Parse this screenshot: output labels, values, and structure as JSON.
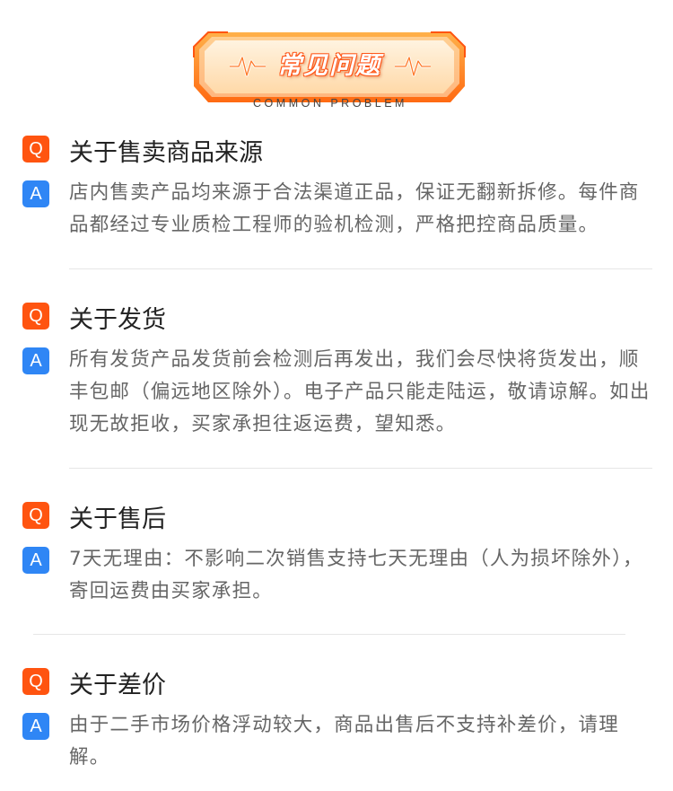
{
  "header": {
    "title": "常见问题",
    "subtitle": "COMMON PROBLEM",
    "colors": {
      "banner_outer": "#ff7a1a",
      "banner_inner": "#ffe0b8",
      "title_fill": "#ffffff"
    }
  },
  "colors": {
    "q_badge": "#ff5410",
    "a_badge": "#2f86f5",
    "question_text": "#222222",
    "answer_text": "#666666",
    "divider": "#e6e6e6"
  },
  "faq": [
    {
      "q_badge": "Q",
      "a_badge": "A",
      "question": "关于售卖商品来源",
      "answer": "店内售卖产品均来源于合法渠道正品，保证无翻新拆修。每件商品都经过专业质检工程师的验机检测，严格把控商品质量。"
    },
    {
      "q_badge": "Q",
      "a_badge": "A",
      "question": "关于发货",
      "answer": "所有发货产品发货前会检测后再发出，我们会尽快将货发出，顺丰包邮（偏远地区除外）。电子产品只能走陆运，敬请谅解。如出现无故拒收，买家承担往返运费，望知悉。"
    },
    {
      "q_badge": "Q",
      "a_badge": "A",
      "question": "关于售后",
      "answer": "7天无理由：不影响二次销售支持七天无理由（人为损坏除外），寄回运费由买家承担。"
    },
    {
      "q_badge": "Q",
      "a_badge": "A",
      "question": "关于差价",
      "answer": "由于二手市场价格浮动较大，商品出售后不支持补差价，请理解。"
    }
  ]
}
